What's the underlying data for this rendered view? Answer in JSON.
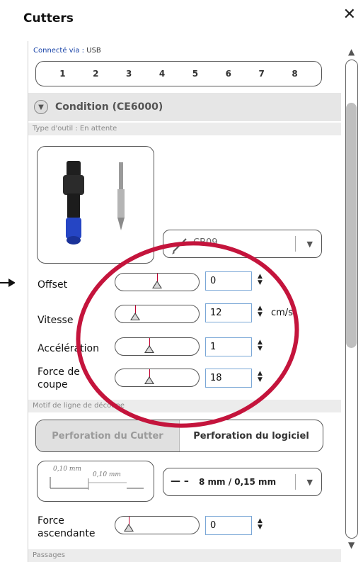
{
  "window": {
    "title": "Cutters",
    "close_symbol": "✕"
  },
  "connection": {
    "label": "Connecté via :",
    "value": "USB"
  },
  "ports": [
    "1",
    "2",
    "3",
    "4",
    "5",
    "6",
    "7",
    "8"
  ],
  "condition": {
    "header": "Condition (CE6000)",
    "tool_type": "Type d'outil : En attente",
    "blade_code": "CB09"
  },
  "settings": {
    "offset": {
      "label": "Offset",
      "value": "0",
      "position": 0.46
    },
    "speed": {
      "label": "Vitesse",
      "value": "12",
      "unit": "cm/s",
      "position": 0.1
    },
    "acceleration": {
      "label": "Accélération",
      "value": "1",
      "position": 0.33
    },
    "force": {
      "label_line1": "Force de",
      "label_line2": "coupe",
      "value": "18",
      "position": 0.33
    }
  },
  "pattern": {
    "section_label": "Motif de ligne de découpe",
    "tabs": [
      "Perforation du Cutter",
      "Perforation du logiciel"
    ],
    "dim_a": "0,10 mm",
    "dim_b": "0,10 mm",
    "line_value": "8 mm / 0,15 mm"
  },
  "lift": {
    "label_line1": "Force",
    "label_line2": "ascendante",
    "value": "0",
    "position": 0.0
  },
  "passes": {
    "section_label": "Passages"
  },
  "colors": {
    "annotation": "#c4143c",
    "link": "#1a44a8"
  }
}
